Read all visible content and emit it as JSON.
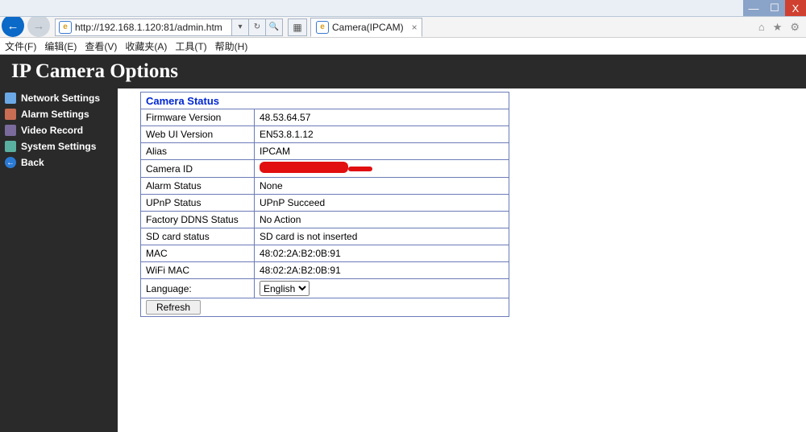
{
  "window": {
    "min": "—",
    "max": "☐",
    "close": "X"
  },
  "ie": {
    "url": "http://192.168.1.120:81/admin.htm",
    "refresh_glyph": "↻",
    "search_glyph": "🔍",
    "tab_title": "Camera(IPCAM)",
    "tab_close": "×",
    "home_glyph": "⌂",
    "star_glyph": "★",
    "gear_glyph": "⚙"
  },
  "menu": {
    "file": "文件(F)",
    "edit": "编辑(E)",
    "view": "查看(V)",
    "fav": "收藏夹(A)",
    "tools": "工具(T)",
    "help": "帮助(H)"
  },
  "header": {
    "title": "IP Camera Options"
  },
  "sidebar": {
    "items": [
      {
        "label": "Network Settings"
      },
      {
        "label": "Alarm Settings"
      },
      {
        "label": "Video Record"
      },
      {
        "label": "System Settings"
      }
    ],
    "back": "Back"
  },
  "status": {
    "title": "Camera Status",
    "rows": [
      {
        "label": "Firmware Version",
        "value": "48.53.64.57"
      },
      {
        "label": "Web UI Version",
        "value": "EN53.8.1.12"
      },
      {
        "label": "Alias",
        "value": "IPCAM"
      },
      {
        "label": "Camera ID",
        "value": "[redacted]"
      },
      {
        "label": "Alarm Status",
        "value": "None"
      },
      {
        "label": "UPnP Status",
        "value": "UPnP Succeed"
      },
      {
        "label": "Factory DDNS Status",
        "value": "No Action"
      },
      {
        "label": "SD card status",
        "value": "SD card is not inserted"
      },
      {
        "label": "MAC",
        "value": "48:02:2A:B2:0B:91"
      },
      {
        "label": "WiFi MAC",
        "value": "48:02:2A:B2:0B:91"
      }
    ],
    "language_label": "Language:",
    "language_value": "English",
    "refresh_label": "Refresh"
  }
}
